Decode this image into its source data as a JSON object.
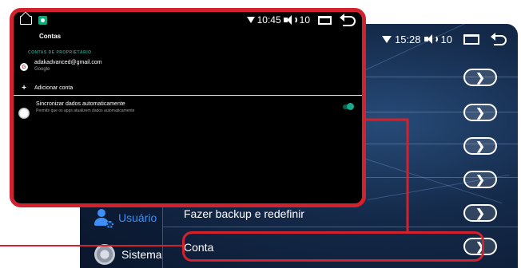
{
  "device": {
    "status": {
      "time": "15:28",
      "volume": "10"
    },
    "sidebar": [
      {
        "label": "Usuário",
        "icon": "user-settings-icon",
        "active": true
      },
      {
        "label": "Sistema",
        "icon": "system-gear-icon",
        "active": false
      }
    ],
    "rows": [
      {
        "label": "",
        "action": "chevron-right-icon"
      },
      {
        "label": "",
        "action": "chevron-right-icon"
      },
      {
        "label": "",
        "action": "chevron-right-icon"
      },
      {
        "label": "",
        "action": "chevron-right-icon"
      },
      {
        "label": "Fazer backup e redefinir",
        "action": "chevron-right-icon"
      },
      {
        "label": "Conta",
        "action": "chevron-right-icon"
      }
    ],
    "colors": {
      "active": "#3d8ef7",
      "background": "#142a4a"
    }
  },
  "overlay": {
    "status": {
      "time": "10:45",
      "volume": "10"
    },
    "title": "Contas",
    "section_label": "CONTAS DE PROPRIETÁRIO",
    "account": {
      "email": "adakadvanced@gmail.com",
      "provider": "Google"
    },
    "add_account": "Adicionar conta",
    "sync": {
      "title": "Sincronizar dados automaticamente",
      "subtitle": "Permitir que os apps atualizem dados automaticamente",
      "enabled": true
    },
    "colors": {
      "accent": "#1aa88f",
      "frame": "#d2222e"
    }
  }
}
